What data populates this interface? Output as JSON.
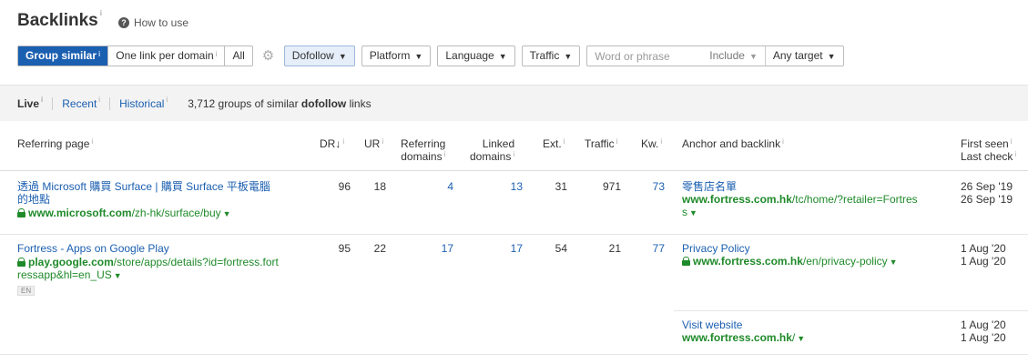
{
  "page": {
    "title": "Backlinks",
    "how_to_use": "How to use"
  },
  "toolbar": {
    "group_similar": "Group similar",
    "one_link_per_domain": "One link per domain",
    "all": "All",
    "dofollow": "Dofollow",
    "platform": "Platform",
    "language": "Language",
    "traffic": "Traffic",
    "search_placeholder": "Word or phrase",
    "include": "Include",
    "any_target": "Any target"
  },
  "subtabs": {
    "live": "Live",
    "recent": "Recent",
    "historical": "Historical"
  },
  "summary": {
    "prefix": "3,712 groups of similar ",
    "bold": "dofollow",
    "suffix": " links"
  },
  "columns": {
    "referring_page": "Referring page",
    "dr": "DR",
    "ur": "UR",
    "ref_domains_1": "Referring",
    "ref_domains_2": "domains",
    "linked_domains_1": "Linked",
    "linked_domains_2": "domains",
    "ext": "Ext.",
    "traffic": "Traffic",
    "kw": "Kw.",
    "anchor": "Anchor and backlink",
    "first_seen": "First seen",
    "last_check": "Last check"
  },
  "rows": [
    {
      "title_1": "透過 Microsoft 購買 Surface | 購買 Surface 平板電腦",
      "title_2": "的地點",
      "domain": "www.microsoft.com",
      "path": "/zh-hk/surface/buy",
      "dr": "96",
      "ur": "18",
      "ref_domains": "4",
      "linked_domains": "13",
      "ext": "31",
      "traffic": "971",
      "kw": "73",
      "anchor_text": "零售店名單",
      "backlink_domain": "www.fortress.com.hk",
      "backlink_path_1": "/tc/home/?retailer=Fortres",
      "backlink_path_2": "s",
      "first_seen": "26 Sep '19",
      "last_check": "26 Sep '19"
    },
    {
      "title_1": "Fortress - Apps on Google Play",
      "domain": "play.google.com",
      "path_1": "/store/apps/details?id=fortress.fort",
      "path_2": "ressapp&hl=en_US",
      "lang_badge": "EN",
      "dr": "95",
      "ur": "22",
      "ref_domains": "17",
      "linked_domains": "17",
      "ext": "54",
      "traffic": "21",
      "kw": "77",
      "anchor_text": "Privacy Policy",
      "backlink_domain": "www.fortress.com.hk",
      "backlink_path": "/en/privacy-policy",
      "first_seen": "1 Aug '20",
      "last_check": "1 Aug '20",
      "sub": {
        "anchor_text": "Visit website",
        "backlink_domain": "www.fortress.com.hk",
        "backlink_path": "/",
        "first_seen": "1 Aug '20",
        "last_check": "1 Aug '20"
      }
    }
  ],
  "info_mark": "i",
  "sort_arrow": "↓",
  "caret": "▼",
  "icons": [
    "question-icon",
    "gear-icon",
    "lock-icon",
    "caret-down-icon"
  ],
  "colors": {
    "accent": "#1b5fb0",
    "link_green": "#1f8a2a"
  }
}
